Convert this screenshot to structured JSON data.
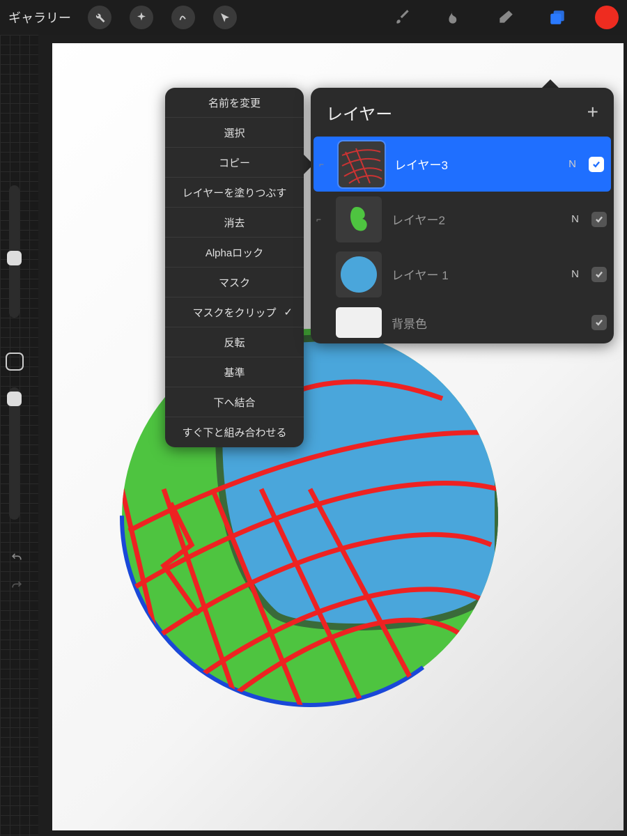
{
  "toolbar": {
    "gallery": "ギャラリー",
    "icons": {
      "wrench": "wrench-icon",
      "adjust": "adjust-icon",
      "select": "select-icon",
      "arrow": "cursor-icon",
      "brush": "brush-icon",
      "smudge": "smudge-icon",
      "eraser": "eraser-icon",
      "layers": "layers-icon",
      "color": "color-icon"
    },
    "color": "#ee2c20"
  },
  "context_menu": {
    "items": [
      {
        "label": "名前を変更",
        "checked": false
      },
      {
        "label": "選択",
        "checked": false
      },
      {
        "label": "コピー",
        "checked": false
      },
      {
        "label": "レイヤーを塗りつぶす",
        "checked": false
      },
      {
        "label": "消去",
        "checked": false
      },
      {
        "label": "Alphaロック",
        "checked": false
      },
      {
        "label": "マスク",
        "checked": false
      },
      {
        "label": "マスクをクリップ",
        "checked": true
      },
      {
        "label": "反転",
        "checked": false
      },
      {
        "label": "基準",
        "checked": false
      },
      {
        "label": "下へ結合",
        "checked": false
      },
      {
        "label": "すぐ下と組み合わせる",
        "checked": false
      }
    ]
  },
  "layers_panel": {
    "title": "レイヤー",
    "add_label": "+",
    "layers": [
      {
        "name": "レイヤー3",
        "blend": "N",
        "visible": true,
        "selected": true,
        "clipped": true
      },
      {
        "name": "レイヤー2",
        "blend": "N",
        "visible": true,
        "selected": false,
        "clipped": true
      },
      {
        "name": "レイヤー 1",
        "blend": "N",
        "visible": true,
        "selected": false,
        "clipped": false
      }
    ],
    "background": {
      "name": "背景色",
      "visible": true
    }
  }
}
